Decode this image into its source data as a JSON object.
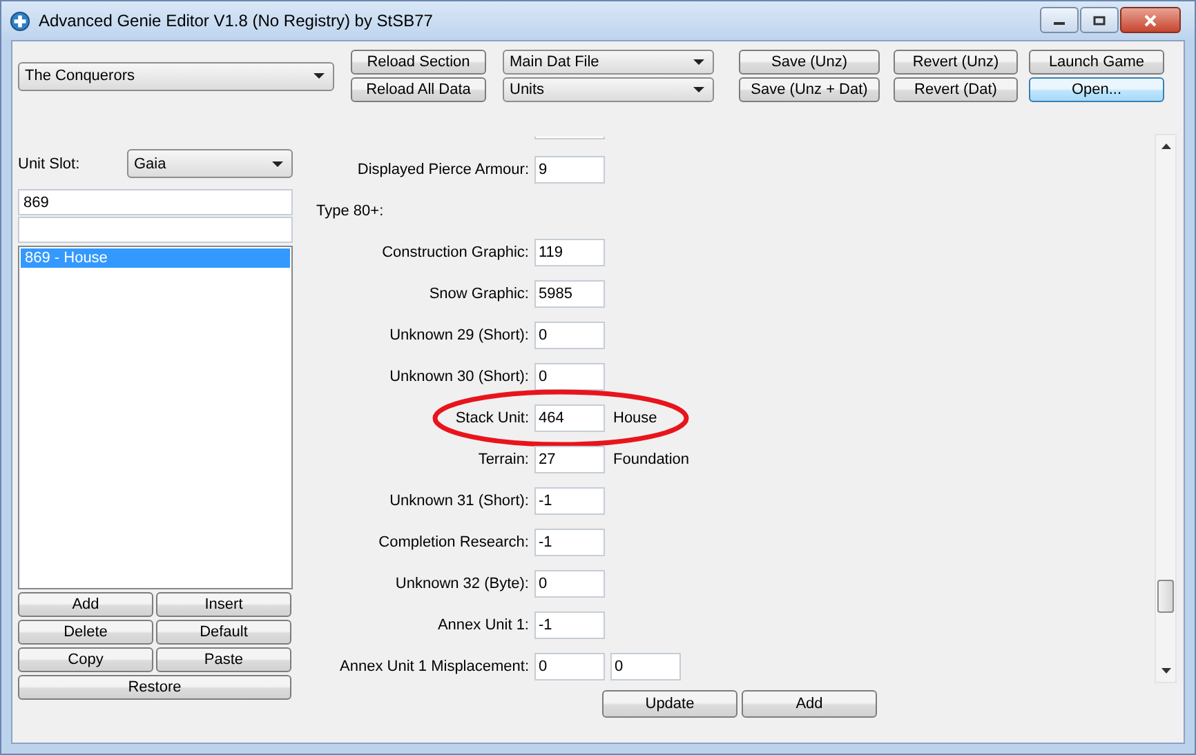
{
  "window": {
    "title": "Advanced Genie Editor V1.8 (No Registry) by StSB77"
  },
  "toolbar": {
    "game_select": "The Conquerors",
    "reload_buttons": [
      "Reload Section",
      "Reload All Data"
    ],
    "file_select": "Main Dat File",
    "section_select": "Units",
    "save_buttons": [
      "Save (Unz)",
      "Save (Unz + Dat)"
    ],
    "revert_buttons": [
      "Revert (Unz)",
      "Revert (Dat)"
    ],
    "launch_button": "Launch Game",
    "open_button": {
      "label": "Open...",
      "focused": true
    }
  },
  "unit_panel": {
    "slot_label": "Unit Slot:",
    "slot_select": "Gaia",
    "search": "869",
    "units": [
      {
        "label": "869 - House",
        "selected": true
      }
    ],
    "buttons": [
      "Add",
      "Insert",
      "Delete",
      "Default",
      "Copy",
      "Paste",
      "Restore"
    ]
  },
  "form": {
    "fields": [
      {
        "kind": "field",
        "label": "Displayed Pierce Armour:",
        "values": [
          "9"
        ],
        "highlighted": false
      },
      {
        "kind": "heading",
        "label": "Type 80+:"
      },
      {
        "kind": "field",
        "label": "Construction Graphic:",
        "values": [
          "119"
        ],
        "highlighted": false
      },
      {
        "kind": "field",
        "label": "Snow Graphic:",
        "values": [
          "5985"
        ],
        "highlighted": false
      },
      {
        "kind": "field",
        "label": "Unknown 29 (Short):",
        "values": [
          "0"
        ],
        "highlighted": false
      },
      {
        "kind": "field",
        "label": "Unknown 30 (Short):",
        "values": [
          "0"
        ],
        "highlighted": false
      },
      {
        "kind": "field",
        "label": "Stack Unit:",
        "values": [
          "464"
        ],
        "note": "House",
        "highlighted": true
      },
      {
        "kind": "field",
        "label": "Terrain:",
        "values": [
          "27"
        ],
        "note": "Foundation",
        "highlighted": false
      },
      {
        "kind": "field",
        "label": "Unknown 31 (Short):",
        "values": [
          "-1"
        ],
        "highlighted": false
      },
      {
        "kind": "field",
        "label": "Completion Research:",
        "values": [
          "-1"
        ],
        "highlighted": false
      },
      {
        "kind": "field",
        "label": "Unknown 32 (Byte):",
        "values": [
          "0"
        ],
        "highlighted": false
      },
      {
        "kind": "field",
        "label": "Annex Unit 1:",
        "values": [
          "-1"
        ],
        "highlighted": false
      },
      {
        "kind": "field",
        "label": "Annex Unit 1 Misplacement:",
        "values": [
          "0",
          "0"
        ],
        "highlighted": false
      }
    ],
    "buttons": [
      "Update",
      "Add"
    ]
  }
}
